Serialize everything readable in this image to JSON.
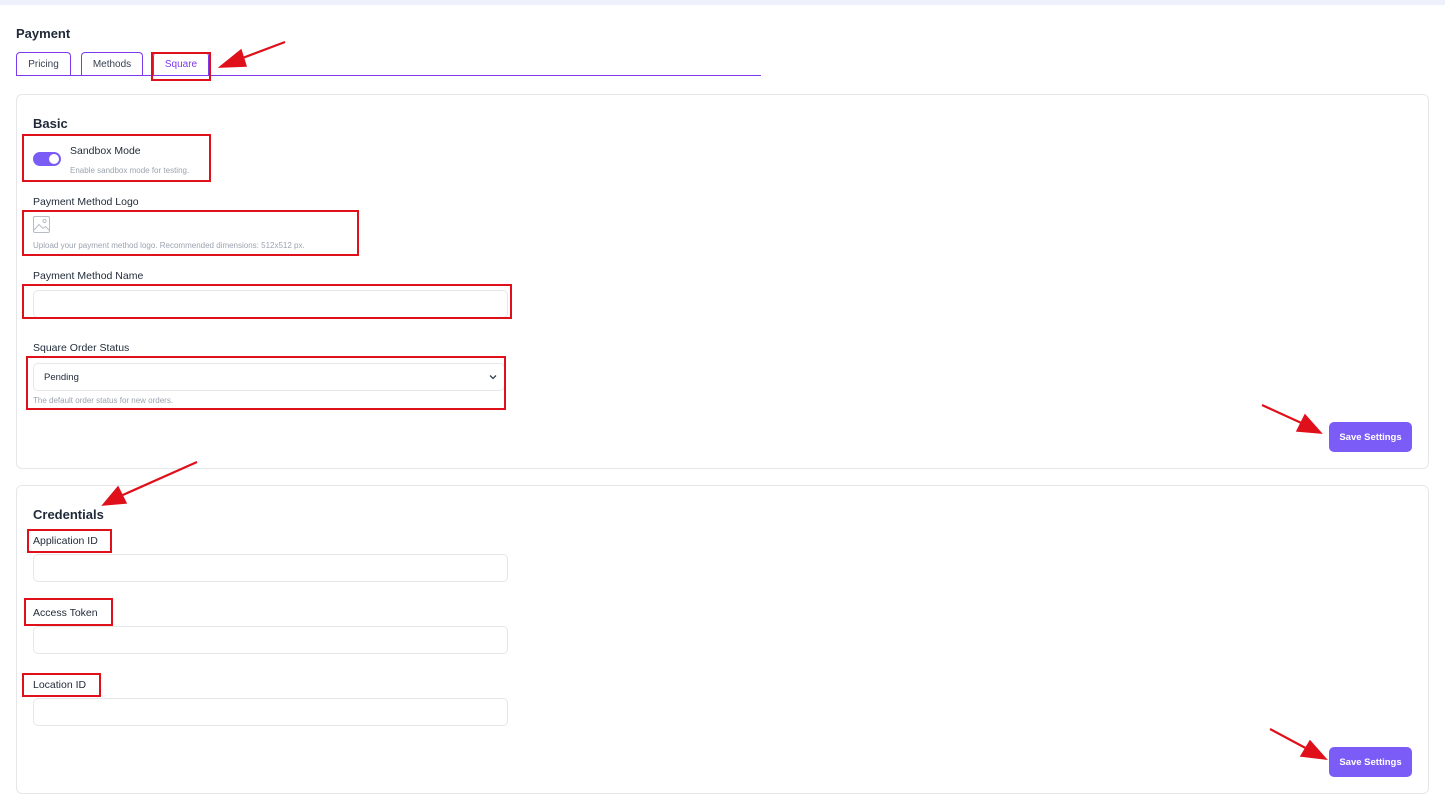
{
  "page": {
    "title": "Payment"
  },
  "tabs": [
    {
      "label": "Pricing"
    },
    {
      "label": "Methods"
    },
    {
      "label": "Square",
      "active": true
    }
  ],
  "basic": {
    "title": "Basic",
    "sandbox": {
      "label": "Sandbox Mode",
      "help": "Enable sandbox mode for testing.",
      "enabled": true
    },
    "logo": {
      "label": "Payment Method Logo",
      "icon": "image-placeholder-icon",
      "help": "Upload your payment method logo. Recommended dimensions: 512x512 px."
    },
    "method_name": {
      "label": "Payment Method Name",
      "value": "",
      "placeholder": ""
    },
    "order_status": {
      "label": "Square Order Status",
      "selected": "Pending",
      "help": "The default order status for new orders."
    },
    "save_label": "Save Settings"
  },
  "credentials": {
    "title": "Credentials",
    "application_id": {
      "label": "Application ID",
      "value": ""
    },
    "access_token": {
      "label": "Access Token",
      "value": ""
    },
    "location_id": {
      "label": "Location ID",
      "value": ""
    },
    "save_label": "Save Settings"
  },
  "colors": {
    "accent": "#7c5cf6",
    "annotation": "#e0101b",
    "border": "#e5e7eb"
  }
}
